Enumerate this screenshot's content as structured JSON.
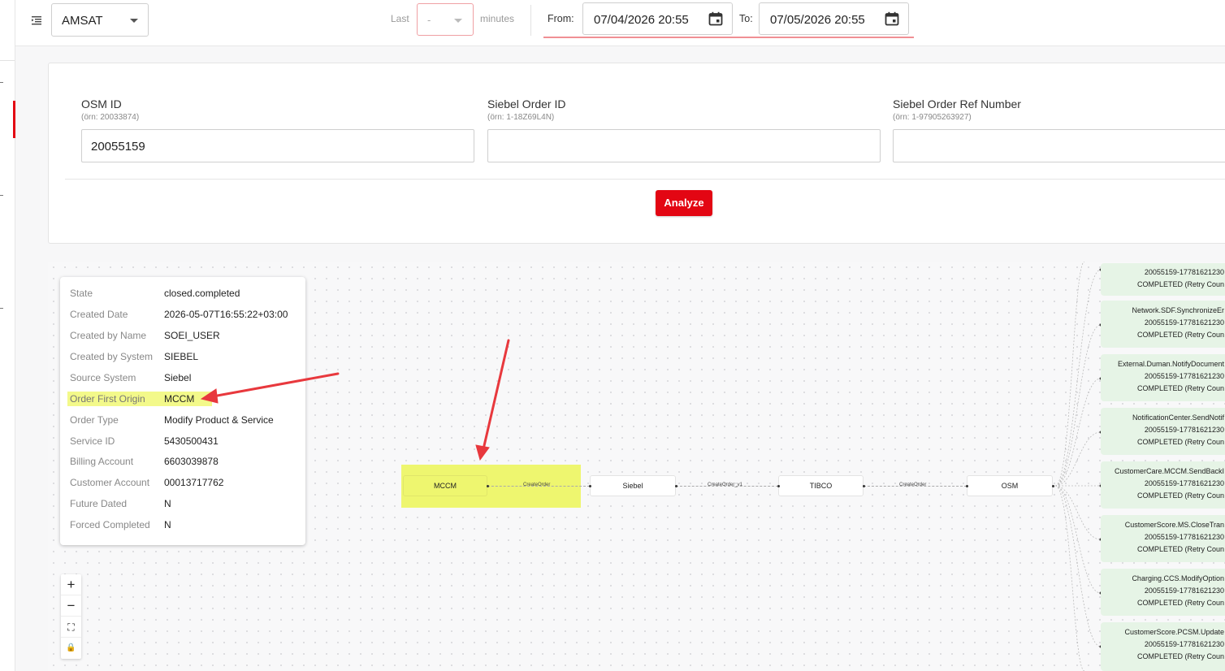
{
  "header": {
    "env_value": "AMSAT",
    "last_label": "Last",
    "last_value": "-",
    "minutes_label": "minutes",
    "from_label": "From:",
    "from_value": "07/04/2026 20:55",
    "to_label": "To:",
    "to_value": "07/05/2026 20:55"
  },
  "search": {
    "fields": [
      {
        "label": "OSM ID",
        "hint": "(örn: 20033874)",
        "value": "20055159"
      },
      {
        "label": "Siebel Order ID",
        "hint": "(örn: 1-18Z69L4N)",
        "value": ""
      },
      {
        "label": "Siebel Order Ref Number",
        "hint": "(örn: 1-97905263927)",
        "value": ""
      }
    ],
    "analyze_label": "Analyze"
  },
  "info": [
    {
      "key": "State",
      "value": "closed.completed"
    },
    {
      "key": "Created Date",
      "value": "2026-05-07T16:55:22+03:00"
    },
    {
      "key": "Created by Name",
      "value": "SOEI_USER"
    },
    {
      "key": "Created by System",
      "value": "SIEBEL"
    },
    {
      "key": "Source System",
      "value": "Siebel"
    },
    {
      "key": "Order First Origin",
      "value": "MCCM"
    },
    {
      "key": "Order Type",
      "value": "Modify Product & Service"
    },
    {
      "key": "Service ID",
      "value": "5430500431"
    },
    {
      "key": "Billing Account",
      "value": "6603039878"
    },
    {
      "key": "Customer Account",
      "value": "00013717762"
    },
    {
      "key": "Future Dated",
      "value": "N"
    },
    {
      "key": "Forced Completed",
      "value": "N"
    }
  ],
  "zoom": {
    "plus": "+",
    "minus": "−",
    "fit": "⛶",
    "lock": "🔒"
  },
  "flow": {
    "nodes": [
      "MCCM",
      "Siebel",
      "TIBCO",
      "OSM"
    ],
    "edges": [
      "CreateOrder",
      "CreateOrder_v1",
      "CreateOrder"
    ]
  },
  "tasks": [
    {
      "line1": "20055159-17781621230",
      "line2": "COMPLETED (Retry Coun"
    },
    {
      "name": "Network.SDF.SynchronizeEr",
      "line1": "20055159-17781621230",
      "line2": "COMPLETED (Retry Coun"
    },
    {
      "name": "External.Duman.NotifyDocument",
      "line1": "20055159-17781621230",
      "line2": "COMPLETED (Retry Coun"
    },
    {
      "name": "NotificationCenter.SendNotif",
      "line1": "20055159-17781621230",
      "line2": "COMPLETED (Retry Coun"
    },
    {
      "name": "CustomerCare.MCCM.SendBackI",
      "line1": "20055159-17781621230",
      "line2": "COMPLETED (Retry Coun"
    },
    {
      "name": "CustomerScore.MS.CloseTran",
      "line1": "20055159-17781621230",
      "line2": "COMPLETED (Retry Coun"
    },
    {
      "name": "Charging.CCS.ModifyOption",
      "line1": "20055159-17781621230",
      "line2": "COMPLETED (Retry Coun"
    },
    {
      "name": "CustomerScore.PCSM.Update",
      "line1": "20055159-17781621230",
      "line2": "COMPLETED (Retry Coun"
    }
  ],
  "colors": {
    "accent": "#e30613",
    "highlight": "#eef66f",
    "task_bg": "#e6f4e6"
  }
}
